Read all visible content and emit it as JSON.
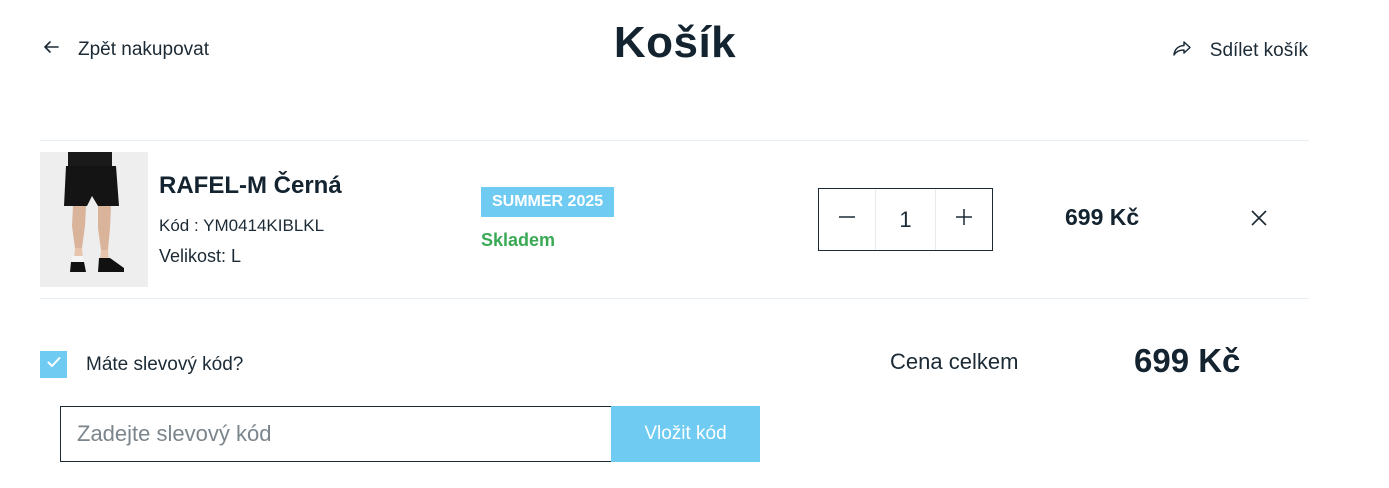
{
  "header": {
    "back_label": "Zpět nakupovat",
    "title": "Košík",
    "share_label": "Sdílet košík"
  },
  "item": {
    "name": "RAFEL-M Černá",
    "code": "Kód : YM0414KIBLKL",
    "size": "Velikost: L",
    "badge": "SUMMER 2025",
    "stock": "Skladem",
    "quantity": "1",
    "price": "699 Kč"
  },
  "summary": {
    "discount_question": "Máte slevový kód?",
    "discount_checked": true,
    "total_label": "Cena celkem",
    "total_value": "699 Kč"
  },
  "discount": {
    "placeholder": "Zadejte slevový kód",
    "button_label": "Vložit kód"
  },
  "icons": {
    "back": "arrow-left-icon",
    "share": "share-icon",
    "minus": "minus-icon",
    "plus": "plus-icon",
    "remove": "close-icon",
    "check": "check-icon"
  },
  "colors": {
    "accent": "#6fcbf2",
    "stock": "#3aa955",
    "text": "#1b2a35"
  }
}
